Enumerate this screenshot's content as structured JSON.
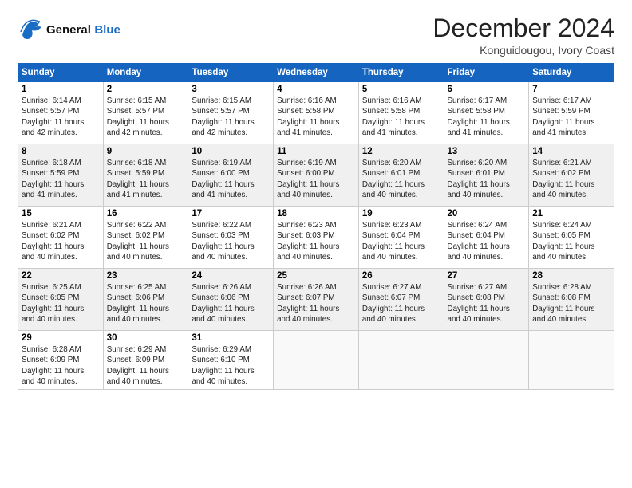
{
  "header": {
    "logo_line1": "General",
    "logo_line2": "Blue",
    "month_title": "December 2024",
    "location": "Konguidougou, Ivory Coast"
  },
  "days_of_week": [
    "Sunday",
    "Monday",
    "Tuesday",
    "Wednesday",
    "Thursday",
    "Friday",
    "Saturday"
  ],
  "weeks": [
    [
      {
        "day": "1",
        "info": "Sunrise: 6:14 AM\nSunset: 5:57 PM\nDaylight: 11 hours\nand 42 minutes."
      },
      {
        "day": "2",
        "info": "Sunrise: 6:15 AM\nSunset: 5:57 PM\nDaylight: 11 hours\nand 42 minutes."
      },
      {
        "day": "3",
        "info": "Sunrise: 6:15 AM\nSunset: 5:57 PM\nDaylight: 11 hours\nand 42 minutes."
      },
      {
        "day": "4",
        "info": "Sunrise: 6:16 AM\nSunset: 5:58 PM\nDaylight: 11 hours\nand 41 minutes."
      },
      {
        "day": "5",
        "info": "Sunrise: 6:16 AM\nSunset: 5:58 PM\nDaylight: 11 hours\nand 41 minutes."
      },
      {
        "day": "6",
        "info": "Sunrise: 6:17 AM\nSunset: 5:58 PM\nDaylight: 11 hours\nand 41 minutes."
      },
      {
        "day": "7",
        "info": "Sunrise: 6:17 AM\nSunset: 5:59 PM\nDaylight: 11 hours\nand 41 minutes."
      }
    ],
    [
      {
        "day": "8",
        "info": "Sunrise: 6:18 AM\nSunset: 5:59 PM\nDaylight: 11 hours\nand 41 minutes."
      },
      {
        "day": "9",
        "info": "Sunrise: 6:18 AM\nSunset: 5:59 PM\nDaylight: 11 hours\nand 41 minutes."
      },
      {
        "day": "10",
        "info": "Sunrise: 6:19 AM\nSunset: 6:00 PM\nDaylight: 11 hours\nand 41 minutes."
      },
      {
        "day": "11",
        "info": "Sunrise: 6:19 AM\nSunset: 6:00 PM\nDaylight: 11 hours\nand 40 minutes."
      },
      {
        "day": "12",
        "info": "Sunrise: 6:20 AM\nSunset: 6:01 PM\nDaylight: 11 hours\nand 40 minutes."
      },
      {
        "day": "13",
        "info": "Sunrise: 6:20 AM\nSunset: 6:01 PM\nDaylight: 11 hours\nand 40 minutes."
      },
      {
        "day": "14",
        "info": "Sunrise: 6:21 AM\nSunset: 6:02 PM\nDaylight: 11 hours\nand 40 minutes."
      }
    ],
    [
      {
        "day": "15",
        "info": "Sunrise: 6:21 AM\nSunset: 6:02 PM\nDaylight: 11 hours\nand 40 minutes."
      },
      {
        "day": "16",
        "info": "Sunrise: 6:22 AM\nSunset: 6:02 PM\nDaylight: 11 hours\nand 40 minutes."
      },
      {
        "day": "17",
        "info": "Sunrise: 6:22 AM\nSunset: 6:03 PM\nDaylight: 11 hours\nand 40 minutes."
      },
      {
        "day": "18",
        "info": "Sunrise: 6:23 AM\nSunset: 6:03 PM\nDaylight: 11 hours\nand 40 minutes."
      },
      {
        "day": "19",
        "info": "Sunrise: 6:23 AM\nSunset: 6:04 PM\nDaylight: 11 hours\nand 40 minutes."
      },
      {
        "day": "20",
        "info": "Sunrise: 6:24 AM\nSunset: 6:04 PM\nDaylight: 11 hours\nand 40 minutes."
      },
      {
        "day": "21",
        "info": "Sunrise: 6:24 AM\nSunset: 6:05 PM\nDaylight: 11 hours\nand 40 minutes."
      }
    ],
    [
      {
        "day": "22",
        "info": "Sunrise: 6:25 AM\nSunset: 6:05 PM\nDaylight: 11 hours\nand 40 minutes."
      },
      {
        "day": "23",
        "info": "Sunrise: 6:25 AM\nSunset: 6:06 PM\nDaylight: 11 hours\nand 40 minutes."
      },
      {
        "day": "24",
        "info": "Sunrise: 6:26 AM\nSunset: 6:06 PM\nDaylight: 11 hours\nand 40 minutes."
      },
      {
        "day": "25",
        "info": "Sunrise: 6:26 AM\nSunset: 6:07 PM\nDaylight: 11 hours\nand 40 minutes."
      },
      {
        "day": "26",
        "info": "Sunrise: 6:27 AM\nSunset: 6:07 PM\nDaylight: 11 hours\nand 40 minutes."
      },
      {
        "day": "27",
        "info": "Sunrise: 6:27 AM\nSunset: 6:08 PM\nDaylight: 11 hours\nand 40 minutes."
      },
      {
        "day": "28",
        "info": "Sunrise: 6:28 AM\nSunset: 6:08 PM\nDaylight: 11 hours\nand 40 minutes."
      }
    ],
    [
      {
        "day": "29",
        "info": "Sunrise: 6:28 AM\nSunset: 6:09 PM\nDaylight: 11 hours\nand 40 minutes."
      },
      {
        "day": "30",
        "info": "Sunrise: 6:29 AM\nSunset: 6:09 PM\nDaylight: 11 hours\nand 40 minutes."
      },
      {
        "day": "31",
        "info": "Sunrise: 6:29 AM\nSunset: 6:10 PM\nDaylight: 11 hours\nand 40 minutes."
      },
      {
        "day": "",
        "info": ""
      },
      {
        "day": "",
        "info": ""
      },
      {
        "day": "",
        "info": ""
      },
      {
        "day": "",
        "info": ""
      }
    ]
  ]
}
